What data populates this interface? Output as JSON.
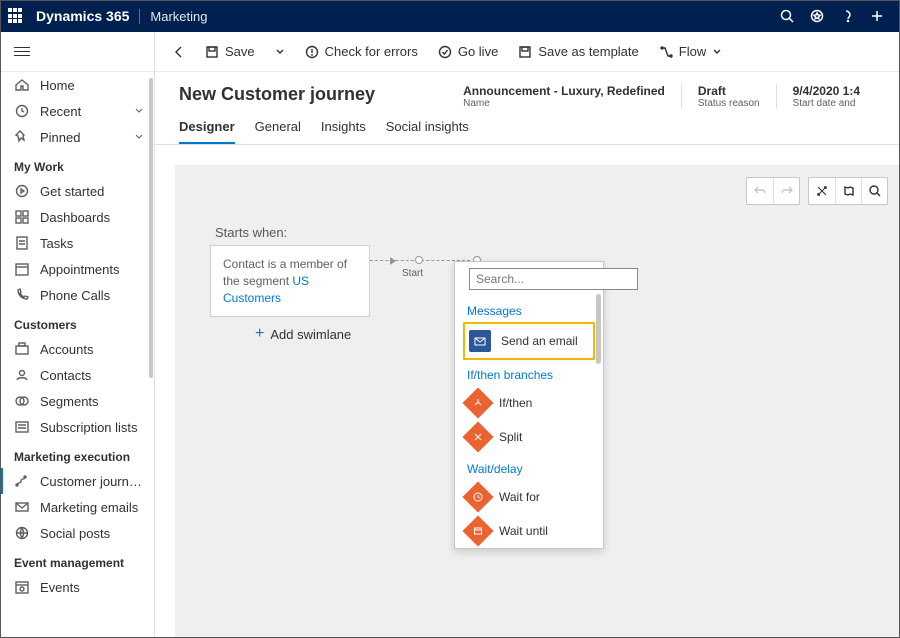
{
  "titlebar": {
    "brand": "Dynamics 365",
    "area": "Marketing"
  },
  "sidebar": {
    "top": [
      {
        "icon": "home",
        "label": "Home"
      },
      {
        "icon": "clock",
        "label": "Recent",
        "expand": true
      },
      {
        "icon": "pin",
        "label": "Pinned",
        "expand": true
      }
    ],
    "groups": [
      {
        "heading": "My Work",
        "items": [
          {
            "icon": "play",
            "label": "Get started"
          },
          {
            "icon": "dashboard",
            "label": "Dashboards"
          },
          {
            "icon": "task",
            "label": "Tasks"
          },
          {
            "icon": "calendar",
            "label": "Appointments"
          },
          {
            "icon": "phone",
            "label": "Phone Calls"
          }
        ]
      },
      {
        "heading": "Customers",
        "items": [
          {
            "icon": "account",
            "label": "Accounts"
          },
          {
            "icon": "contact",
            "label": "Contacts"
          },
          {
            "icon": "segment",
            "label": "Segments"
          },
          {
            "icon": "sublist",
            "label": "Subscription lists"
          }
        ]
      },
      {
        "heading": "Marketing execution",
        "items": [
          {
            "icon": "journey",
            "label": "Customer journeys",
            "selected": true
          },
          {
            "icon": "email",
            "label": "Marketing emails"
          },
          {
            "icon": "social",
            "label": "Social posts"
          }
        ]
      },
      {
        "heading": "Event management",
        "items": [
          {
            "icon": "events",
            "label": "Events"
          }
        ]
      }
    ]
  },
  "commands": {
    "save": "Save",
    "check": "Check for errors",
    "golive": "Go live",
    "template": "Save as template",
    "flow": "Flow"
  },
  "page": {
    "title": "New Customer journey",
    "meta": [
      {
        "value": "Announcement - Luxury, Redefined",
        "label": "Name"
      },
      {
        "value": "Draft",
        "label": "Status reason"
      },
      {
        "value": "9/4/2020 1:4",
        "label": "Start date and"
      }
    ],
    "tabs": [
      "Designer",
      "General",
      "Insights",
      "Social insights"
    ]
  },
  "canvas": {
    "starts_label": "Starts when:",
    "start_text": "Contact is a member of the segment ",
    "start_link": "US Customers",
    "add_swimlane": "Add swimlane",
    "start_node": "Start"
  },
  "popup": {
    "search_placeholder": "Search...",
    "cats": {
      "messages": "Messages",
      "branches": "If/then branches",
      "wait": "Wait/delay"
    },
    "opts": {
      "send_email": "Send an email",
      "ifthen": "If/then",
      "split": "Split",
      "waitfor": "Wait for",
      "waituntil": "Wait until"
    }
  }
}
